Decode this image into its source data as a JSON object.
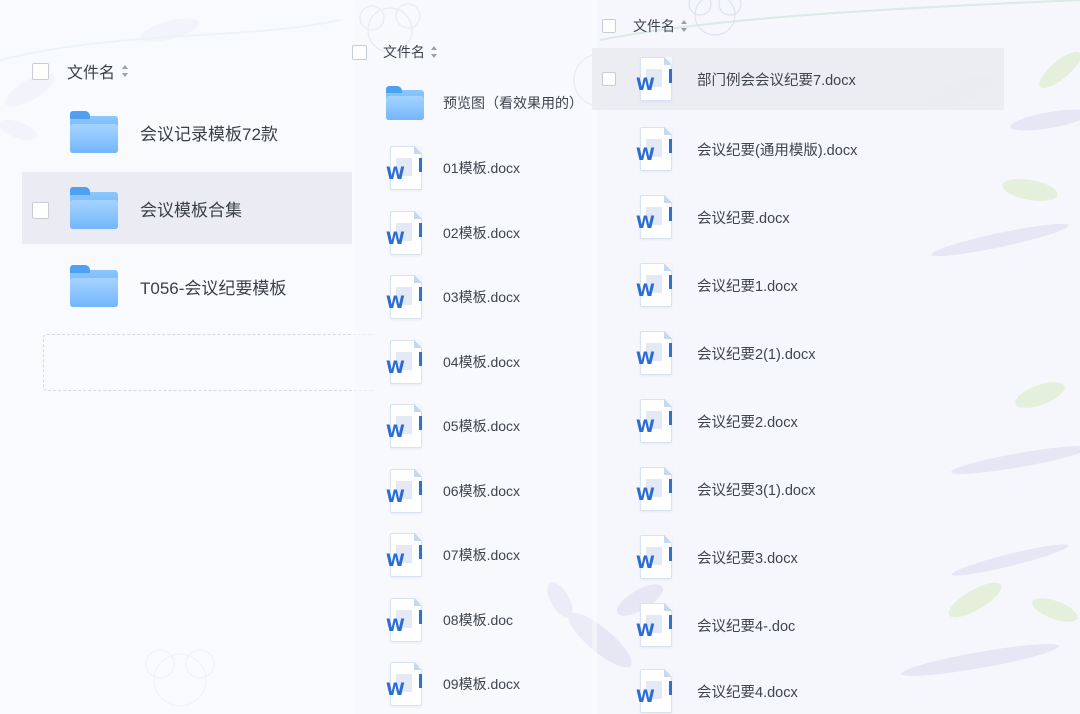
{
  "columns": [
    {
      "header": "文件名",
      "items": [
        {
          "name": "会议记录模板72款",
          "type": "folder"
        },
        {
          "name": "会议模板合集",
          "type": "folder",
          "highlighted": true
        },
        {
          "name": "T056-会议纪要模板",
          "type": "folder"
        }
      ]
    },
    {
      "header": "文件名",
      "items": [
        {
          "name": "预览图（看效果用的）",
          "type": "folder"
        },
        {
          "name": "01模板.docx",
          "type": "word"
        },
        {
          "name": "02模板.docx",
          "type": "word"
        },
        {
          "name": "03模板.docx",
          "type": "word"
        },
        {
          "name": "04模板.docx",
          "type": "word"
        },
        {
          "name": "05模板.docx",
          "type": "word"
        },
        {
          "name": "06模板.docx",
          "type": "word"
        },
        {
          "name": "07模板.docx",
          "type": "word"
        },
        {
          "name": "08模板.doc",
          "type": "word"
        },
        {
          "name": "09模板.docx",
          "type": "word"
        }
      ]
    },
    {
      "header": "文件名",
      "items": [
        {
          "name": "部门例会会议纪要7.docx",
          "type": "word",
          "highlighted": true
        },
        {
          "name": "会议纪要(通用模版).docx",
          "type": "word"
        },
        {
          "name": "会议纪要.docx",
          "type": "word"
        },
        {
          "name": "会议纪要1.docx",
          "type": "word"
        },
        {
          "name": "会议纪要2(1).docx",
          "type": "word"
        },
        {
          "name": "会议纪要2.docx",
          "type": "word"
        },
        {
          "name": "会议纪要3(1).docx",
          "type": "word"
        },
        {
          "name": "会议纪要3.docx",
          "type": "word"
        },
        {
          "name": "会议纪要4-.doc",
          "type": "word"
        },
        {
          "name": "会议纪要4.docx",
          "type": "word"
        }
      ]
    }
  ],
  "icons": {
    "folder": "folder-icon",
    "word": "word-doc-icon",
    "sort": "sort-icon"
  },
  "colors": {
    "folder": "#6fb3f8",
    "word": "#2b6cd6",
    "highlight": "#eaecf2"
  }
}
